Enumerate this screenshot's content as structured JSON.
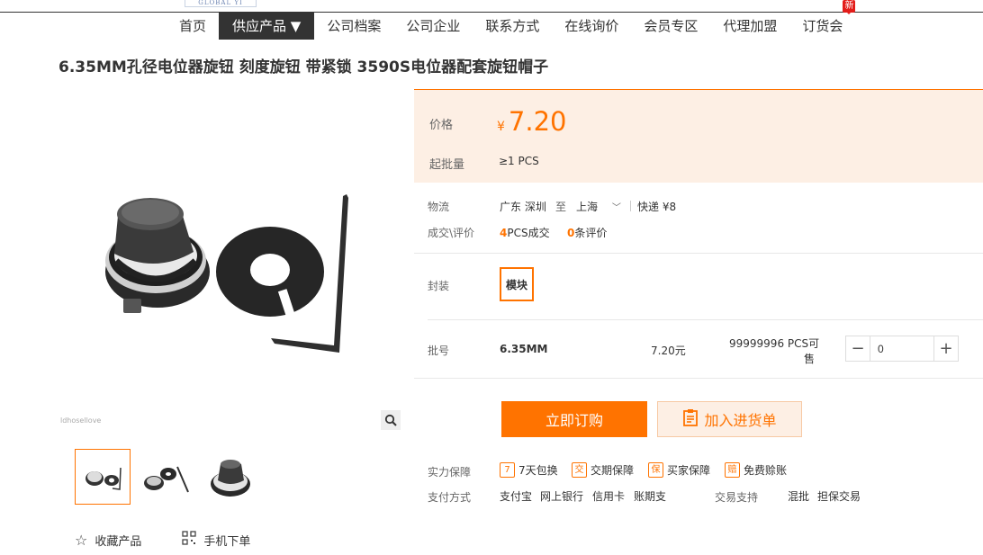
{
  "logo": {
    "text": "GLOBAL  YI"
  },
  "nav": {
    "items": [
      "首页",
      "供应产品 ▼",
      "公司档案",
      "公司企业",
      "联系方式",
      "在线询价",
      "会员专区",
      "代理加盟",
      "订货会"
    ],
    "badge": "新"
  },
  "product": {
    "title": "6.35MM孔径电位器旋钮 刻度旋钮 带紧锁 3590S电位器配套旋钮帽子",
    "watermark": "ldhosellove"
  },
  "price": {
    "label": "价格",
    "currency": "¥",
    "value": "7.20",
    "moq_label": "起批量",
    "moq": "≥1  PCS"
  },
  "logistics": {
    "label": "物流",
    "from": "广东 深圳",
    "to_word": "至",
    "to": "上海",
    "express": "快递 ¥8"
  },
  "trade": {
    "label": "成交\\评价",
    "sold_count": "4",
    "sold_unit": "PCS成交",
    "review_count": "0",
    "review_unit": "条评价"
  },
  "package": {
    "label": "封装",
    "option": "模块"
  },
  "batch": {
    "label": "批号",
    "name": "6.35MM",
    "price": "7.20元",
    "stock_line1": "99999996 PCS可",
    "stock_line2": "售",
    "quantity": "0"
  },
  "buttons": {
    "order": "立即订购",
    "cart": "加入进货单"
  },
  "guarantee": {
    "label": "实力保障",
    "items": [
      {
        "icon": "7",
        "text": "7天包换"
      },
      {
        "icon": "交",
        "text": "交期保障"
      },
      {
        "icon": "保",
        "text": "买家保障"
      },
      {
        "icon": "赔",
        "text": "免费赊账"
      }
    ]
  },
  "payment": {
    "label": "支付方式",
    "methods": [
      "支付宝",
      "网上银行",
      "信用卡",
      "账期支"
    ],
    "trade_label": "交易支持",
    "trade_methods": [
      "混批",
      "担保交易"
    ]
  },
  "actions": {
    "favorite": "收藏产品",
    "mobile": "手机下单"
  },
  "colors": {
    "accent": "#ff7300",
    "price_bg": "#fdefe4",
    "nav_active": "#333333"
  }
}
